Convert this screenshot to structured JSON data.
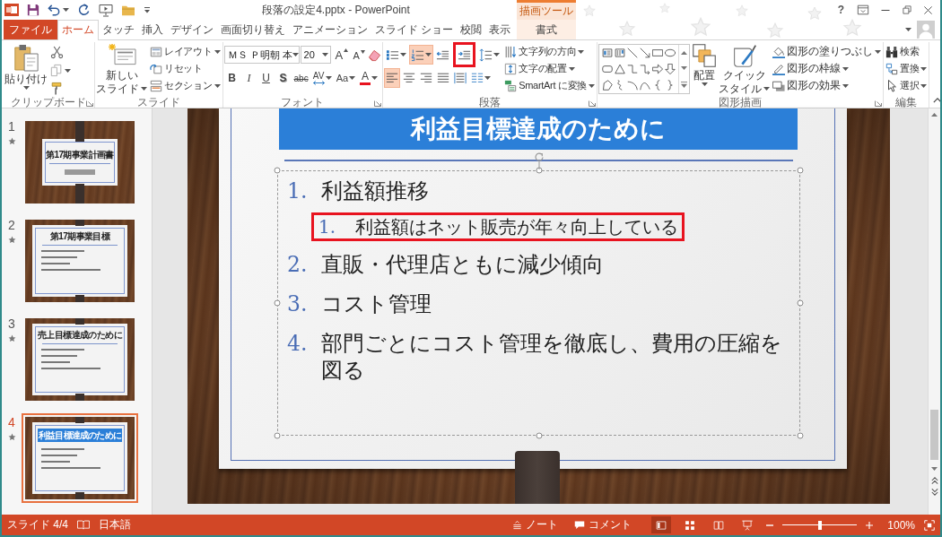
{
  "window": {
    "title": "段落の設定4.pptx - PowerPoint",
    "context_group": "描画ツール",
    "help": "?"
  },
  "tabs": [
    {
      "label": "ファイル",
      "kind": "file",
      "selected": false
    },
    {
      "label": "ホーム",
      "kind": "standard",
      "selected": true
    },
    {
      "label": "タッチ",
      "kind": "standard",
      "selected": false
    },
    {
      "label": "挿入",
      "kind": "standard",
      "selected": false
    },
    {
      "label": "デザイン",
      "kind": "standard",
      "selected": false
    },
    {
      "label": "画面切り替え",
      "kind": "standard",
      "selected": false
    },
    {
      "label": "アニメーション",
      "kind": "standard",
      "selected": false
    },
    {
      "label": "スライド ショー",
      "kind": "standard",
      "selected": false
    },
    {
      "label": "校閲",
      "kind": "standard",
      "selected": false
    },
    {
      "label": "表示",
      "kind": "standard",
      "selected": false
    },
    {
      "label": "書式",
      "kind": "context",
      "selected": false
    }
  ],
  "ribbon": {
    "clipboard": {
      "label": "クリップボード",
      "paste": "貼り付け"
    },
    "slides": {
      "label": "スライド",
      "new_slide": [
        "新しい",
        "スライド"
      ],
      "commands": [
        {
          "kind": "layout",
          "label": "レイアウト",
          "dropdown": true
        },
        {
          "kind": "reset",
          "label": "リセット",
          "dropdown": false
        },
        {
          "kind": "section",
          "label": "セクション",
          "dropdown": true
        }
      ]
    },
    "font": {
      "label": "フォント",
      "font_name": "ＭＳ Ｐ明朝 本",
      "font_size": "20",
      "size_buttons": [
        {
          "kind": "grow",
          "text": "A"
        },
        {
          "kind": "shrink",
          "text": "A"
        }
      ],
      "format_buttons": [
        {
          "kind": "bold",
          "text": "B",
          "dropdown": false
        },
        {
          "kind": "italic",
          "text": "I",
          "dropdown": false
        },
        {
          "kind": "underline",
          "text": "U",
          "dropdown": false
        },
        {
          "kind": "shadow",
          "text": "S",
          "dropdown": false
        },
        {
          "kind": "strikethrough",
          "text": "abc",
          "dropdown": false
        },
        {
          "kind": "spacing",
          "text": "AV",
          "dropdown": true
        },
        {
          "kind": "case",
          "text": "Aa",
          "dropdown": true
        },
        {
          "kind": "color",
          "text": "A",
          "dropdown": true
        }
      ]
    },
    "paragraph": {
      "label": "段落",
      "list_buttons": [
        {
          "kind": "bullets",
          "dropdown": true,
          "selected": false,
          "highlighted": false
        },
        {
          "kind": "numbering",
          "dropdown": true,
          "selected": true,
          "highlighted": false
        },
        {
          "kind": "decrease_indent",
          "dropdown": false,
          "selected": false,
          "highlighted": false
        },
        {
          "kind": "increase_indent",
          "dropdown": false,
          "selected": false,
          "highlighted": true
        },
        {
          "kind": "line_spacing",
          "dropdown": true,
          "selected": false,
          "highlighted": false
        }
      ],
      "align_buttons": [
        {
          "kind": "left",
          "dropdown": false,
          "selected": true
        },
        {
          "kind": "center",
          "dropdown": false,
          "selected": false
        },
        {
          "kind": "right",
          "dropdown": false,
          "selected": false
        },
        {
          "kind": "justify",
          "dropdown": false,
          "selected": false
        },
        {
          "kind": "distribute",
          "dropdown": false,
          "selected": false
        },
        {
          "kind": "columns",
          "dropdown": true,
          "selected": false
        }
      ],
      "text_commands": [
        {
          "kind": "direction",
          "label": "文字列の方向",
          "dropdown": true
        },
        {
          "kind": "align",
          "label": "文字の配置",
          "dropdown": true
        },
        {
          "kind": "smartart",
          "label": "SmartArt に変換",
          "dropdown": true
        }
      ]
    },
    "drawing": {
      "label": "図形描画",
      "arrange": "配置",
      "quick_styles": [
        "クイック",
        "スタイル"
      ],
      "commands": [
        {
          "kind": "fill",
          "label": "図形の塗りつぶし",
          "dropdown": true
        },
        {
          "kind": "outline",
          "label": "図形の枠線",
          "dropdown": true
        },
        {
          "kind": "effects",
          "label": "図形の効果",
          "dropdown": true
        }
      ]
    },
    "editing": {
      "label": "編集",
      "commands": [
        {
          "kind": "find",
          "label": "検索",
          "dropdown": false
        },
        {
          "kind": "replace",
          "label": "置換",
          "dropdown": true
        },
        {
          "kind": "select",
          "label": "選択",
          "dropdown": true
        }
      ]
    }
  },
  "thumbnails": [
    {
      "number": "1",
      "kind": "title",
      "title": "第17期事業計画書",
      "animated": true,
      "selected": false
    },
    {
      "number": "2",
      "kind": "content",
      "title": "第17期事業目標",
      "animated": true,
      "selected": false
    },
    {
      "number": "3",
      "kind": "content",
      "title": "売上目標達成のために",
      "animated": true,
      "selected": false
    },
    {
      "number": "4",
      "kind": "banner",
      "title": "利益目標達成のために",
      "animated": true,
      "selected": true
    }
  ],
  "slide": {
    "title": "利益目標達成のために",
    "items": [
      {
        "number": "1.",
        "text": "利益額推移",
        "highlighted": false,
        "children": [
          {
            "number": "1.",
            "text": "利益額はネット販売が年々向上している",
            "highlighted": true
          }
        ]
      },
      {
        "number": "2.",
        "text": "直販・代理店ともに減少傾向",
        "highlighted": false
      },
      {
        "number": "3.",
        "text": "コスト管理",
        "highlighted": false
      },
      {
        "number": "4.",
        "text": "部門ごとにコスト管理を徹底し、費用の圧縮を図る",
        "highlighted": false
      }
    ]
  },
  "status_bar": {
    "slide": "スライド 4/4",
    "language": "日本語",
    "notes": "ノート",
    "comments": "コメント",
    "views": [
      {
        "kind": "normal",
        "selected": true
      },
      {
        "kind": "sorter",
        "selected": false
      },
      {
        "kind": "reading",
        "selected": false
      },
      {
        "kind": "slideshow",
        "selected": false
      }
    ],
    "zoom": {
      "level": 0.5,
      "reading": "100%"
    }
  }
}
